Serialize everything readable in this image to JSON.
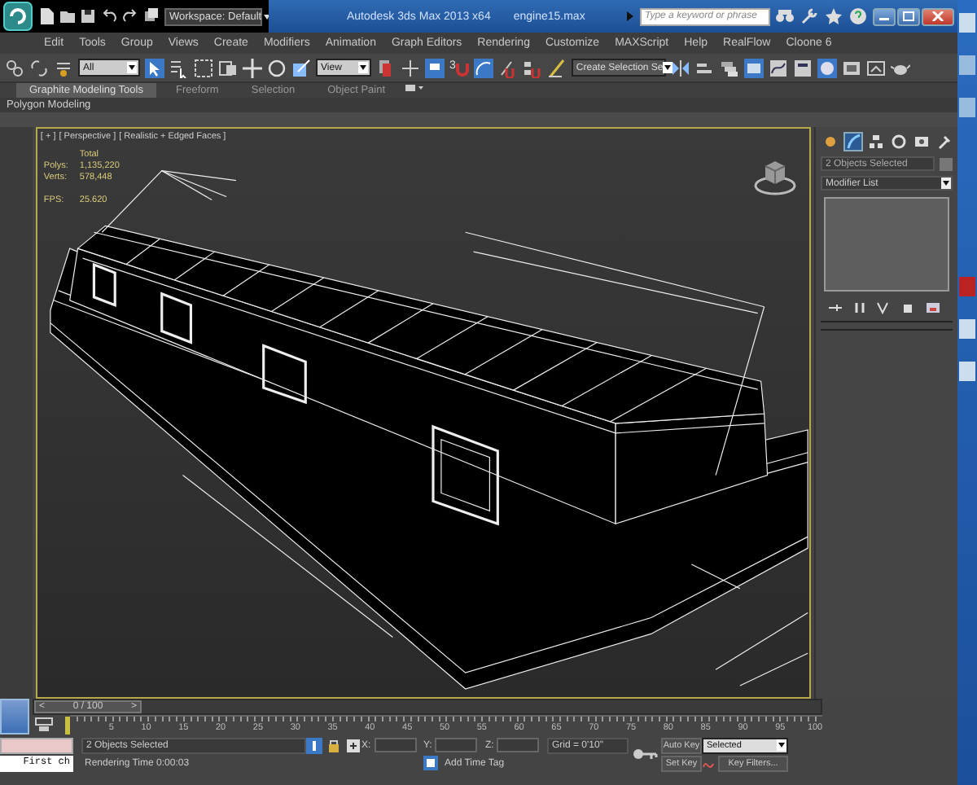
{
  "title_bar": {
    "workspace": "Workspace: Default",
    "title": "Autodesk 3ds Max 2013 x64",
    "file": "engine15.max",
    "search": {
      "placeholder": "Type a keyword or phrase"
    }
  },
  "menu": [
    "Edit",
    "Tools",
    "Group",
    "Views",
    "Create",
    "Modifiers",
    "Animation",
    "Graph Editors",
    "Rendering",
    "Customize",
    "MAXScript",
    "Help",
    "RealFlow",
    "Cloone 6"
  ],
  "toolbar": {
    "selection_filter": "All",
    "reference_coord": "View",
    "snap_label": "3",
    "named_selection": "Create Selection Se"
  },
  "ribbon": {
    "tabs": [
      {
        "label": "Graphite Modeling Tools",
        "selected": true
      },
      {
        "label": "Freeform",
        "selected": false
      },
      {
        "label": "Selection",
        "selected": false
      },
      {
        "label": "Object Paint",
        "selected": false
      }
    ],
    "panel": "Polygon Modeling"
  },
  "viewport": {
    "labels": [
      "[ + ]",
      "[ Perspective ]",
      "[ Realistic + Edged Faces ]"
    ],
    "stats": {
      "heading": "Total",
      "rows": [
        {
          "label": "Polys:",
          "value": "1,135,220"
        },
        {
          "label": "Verts:",
          "value": "578,448"
        },
        {
          "label": "FPS:",
          "value": "25.620"
        }
      ]
    }
  },
  "command_panel": {
    "tabs": [
      {
        "kind": "create",
        "selected": false
      },
      {
        "kind": "modify",
        "selected": true
      },
      {
        "kind": "hierarchy",
        "selected": false
      },
      {
        "kind": "motion",
        "selected": false
      },
      {
        "kind": "display",
        "selected": false
      },
      {
        "kind": "utilities",
        "selected": false
      }
    ],
    "object_name": "2 Objects Selected",
    "modifier_list": "Modifier List"
  },
  "time_slider": {
    "label": "0 / 100",
    "level": 0,
    "prev": "<",
    "next": ">"
  },
  "track": {
    "ticks": [
      "5",
      "10",
      "15",
      "20",
      "25",
      "30",
      "35",
      "40",
      "45",
      "50",
      "55",
      "60",
      "65",
      "70",
      "75",
      "80",
      "85",
      "90",
      "95",
      "100"
    ]
  },
  "status": {
    "listener_output": "First ch",
    "selection": "2 Objects Selected",
    "prompt": "Rendering Time  0:00:03",
    "x_label": "X:",
    "y_label": "Y:",
    "z_label": "Z:",
    "grid": "Grid = 0'10\"",
    "auto_key": "Auto Key",
    "key_mode": "Selected",
    "set_key": "Set Key",
    "key_filters": "Key Filters...",
    "add_time_tag": "Add Time Tag"
  }
}
